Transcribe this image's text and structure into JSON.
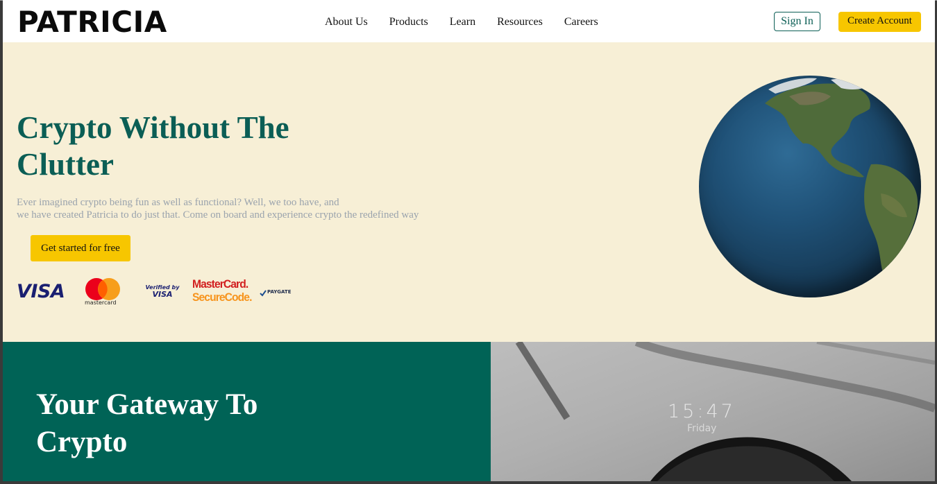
{
  "header": {
    "logo": "PATRICIA",
    "nav": [
      "About Us",
      "Products",
      "Learn",
      "Resources",
      "Careers"
    ],
    "sign_in": "Sign In",
    "create_account": "Create Account"
  },
  "hero": {
    "title": "Crypto Without The Clutter",
    "subtitle_line1": "Ever imagined crypto being fun as well as functional? Well, we too have, and",
    "subtitle_line2": "we have created Patricia to do just that. Come on board and experience crypto the redefined way",
    "cta": "Get started for free",
    "payment_logos": {
      "visa": "VISA",
      "mastercard": "mastercard",
      "verified_by": "Verified by",
      "verified_visa": "VISA",
      "securecode_top": "MasterCard.",
      "securecode_bottom": "SecureCode.",
      "paygate": "PAYGATE"
    }
  },
  "gateway": {
    "title": "Your Gateway To Crypto"
  },
  "photo": {
    "time": "15:47",
    "day": "Friday"
  },
  "colors": {
    "brand_green": "#006356",
    "accent_yellow": "#f7c600",
    "hero_bg": "#f7efd6"
  }
}
